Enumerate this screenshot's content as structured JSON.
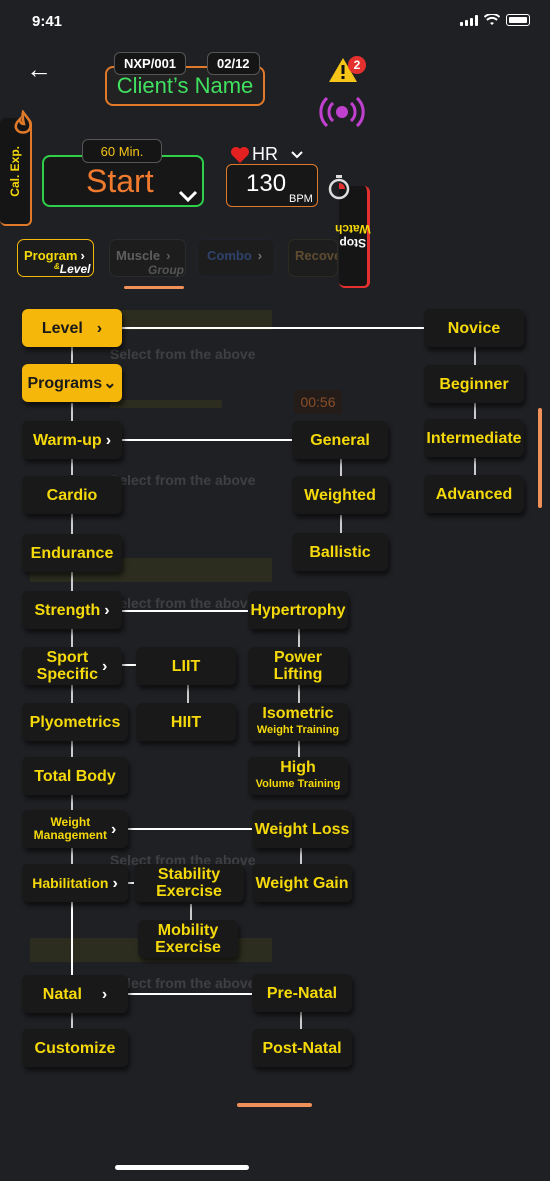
{
  "status": {
    "time": "9:41"
  },
  "header": {
    "client_id": "NXP/001",
    "session": "02/12",
    "client_name": "Client’s Name",
    "alert_count": "2"
  },
  "side": {
    "cal_exp": "Cal. Exp.",
    "stop_watch_a": "Stop ",
    "stop_watch_b": "Watch"
  },
  "timer": {
    "duration": "60 Min.",
    "start_label": "Start"
  },
  "heart_rate": {
    "label": "HR",
    "value": "130",
    "unit": "BPM"
  },
  "tabs": [
    {
      "label": "Program",
      "sub_amp": "&",
      "sub": "Level"
    },
    {
      "label": "Muscle",
      "sub": "Group"
    },
    {
      "label": "Combo"
    },
    {
      "label": "Recove"
    }
  ],
  "ghost": {
    "select_text": "Select from the above",
    "timer": "00:56"
  },
  "col1": {
    "level": "Level",
    "programs": "Programs",
    "warmup": "Warm-up",
    "cardio": "Cardio",
    "endurance": "Endurance",
    "strength": "Strength",
    "sport_a": "Sport",
    "sport_b": "Specific",
    "plyometrics": "Plyometrics",
    "total_body": "Total Body",
    "weight_a": "Weight",
    "weight_b": "Management",
    "habilitation": "Habilitation",
    "natal": "Natal",
    "customize": "Customize"
  },
  "col_mid": {
    "liit": "LIIT",
    "hiit": "HIIT",
    "stability_a": "Stability",
    "stability_b": "Exercise",
    "mobility_a": "Mobility",
    "mobility_b": "Exercise"
  },
  "col3": {
    "general": "General",
    "weighted": "Weighted",
    "ballistic": "Ballistic",
    "hypertrophy": "Hypertrophy",
    "power_a": "Power",
    "power_b": "Lifting",
    "iso_a": "Isometric",
    "iso_b": "Weight Training",
    "high_a": "High",
    "high_b": "Volume Training",
    "weight_loss": "Weight Loss",
    "weight_gain": "Weight Gain",
    "pre_natal": "Pre-Natal",
    "post_natal": "Post-Natal"
  },
  "levels": {
    "novice": "Novice",
    "beginner": "Beginner",
    "intermediate": "Intermediate",
    "advanced": "Advanced"
  },
  "colors": {
    "accent_yellow": "#f5b70a",
    "accent_orange": "#e07a2a",
    "green": "#2fcf4a"
  }
}
